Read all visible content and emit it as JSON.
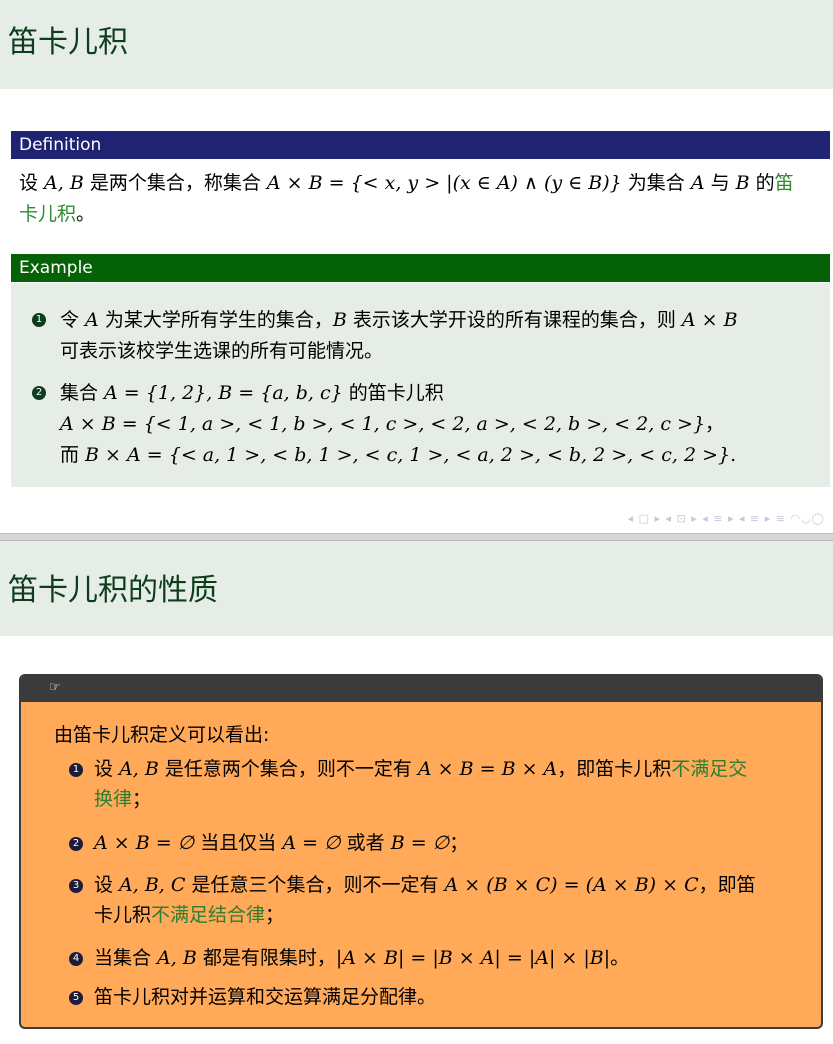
{
  "slide1": {
    "title": "笛卡儿积",
    "definition": {
      "label": "Definition",
      "pre": "设 ",
      "vars": "A, B",
      "mid1": " 是两个集合，称集合 ",
      "formula": "A × B = {< x, y > |(x ∈ A) ∧ (y ∈ B)}",
      "mid2": " 为集合 ",
      "a": "A",
      "mid3": " 与 ",
      "b": "B",
      "mid4": " 的",
      "term_part1": "笛",
      "term_part2": "卡儿积",
      "end": "。"
    },
    "example": {
      "label": "Example",
      "item1_num": "1",
      "item1_pre": "令 ",
      "item1_a": "A",
      "item1_mid1": " 为某大学所有学生的集合，",
      "item1_b": "B",
      "item1_mid2": " 表示该大学开设的所有课程的集合，则 ",
      "item1_axb": "A × B",
      "item1_line2": "可表示该校学生选课的所有可能情况。",
      "item2_num": "2",
      "item2_pre": "集合 ",
      "item2_sets": "A = {1, 2}, B = {a, b, c}",
      "item2_post": " 的笛卡儿积",
      "item2_line2": "A × B = {< 1, a >, < 1, b >, < 1, c >, < 2, a >, < 2, b >, < 2, c >}",
      "item2_line2_end": "，",
      "item2_line3_pre": "而 ",
      "item2_line3": "B × A = {< a, 1 >, < b, 1 >, < c, 1 >, < a, 2 >, < b, 2 >, < c, 2 >}."
    },
    "nav_symbols": "◂ □ ▸ ◂ ⊡ ▸ ◂ ≡ ▸ ◂ ≡ ▸   ≡   ◠◡◯"
  },
  "slide2": {
    "title": "笛卡儿积的性质",
    "note_icon": "☞",
    "intro": "由笛卡儿积定义可以看出:",
    "items": [
      {
        "num": "1",
        "pre": "设 ",
        "math1": "A, B",
        "mid": " 是任意两个集合，则不一定有 ",
        "math2": "A × B = B × A",
        "post": "，即笛卡儿积",
        "hl1": "不满足交",
        "hl2": "换律",
        "end": "；"
      },
      {
        "num": "2",
        "math1": "A × B = ∅",
        "mid": " 当且仅当 ",
        "math2": "A = ∅",
        "mid2": " 或者 ",
        "math3": "B = ∅",
        "end": "；"
      },
      {
        "num": "3",
        "pre": "设 ",
        "math1": "A, B, C",
        "mid": " 是任意三个集合，则不一定有 ",
        "math2": "A × (B × C) = (A × B) × C",
        "post": "，即笛",
        "line2": "卡儿积",
        "hl": "不满足结合律",
        "end": "；"
      },
      {
        "num": "4",
        "pre": "当集合 ",
        "math1": "A, B",
        "mid": " 都是有限集时，",
        "math2": "|A × B| = |B × A| = |A| × |B|",
        "end": "。"
      },
      {
        "num": "5",
        "text": "笛卡儿积对并运算和交运算满足分配律。"
      }
    ]
  }
}
